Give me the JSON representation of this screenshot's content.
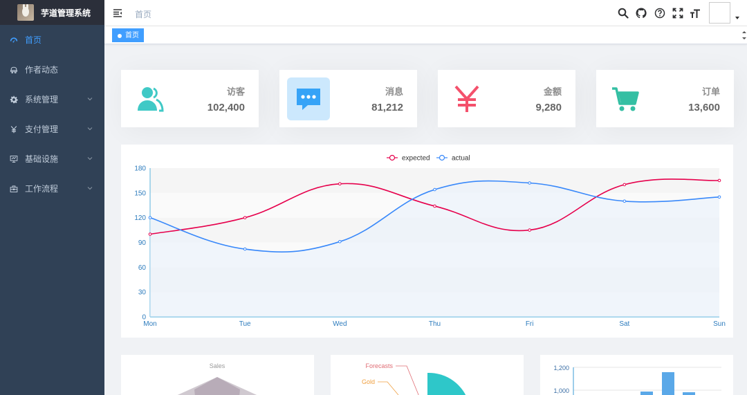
{
  "app": {
    "title": "芋道管理系统"
  },
  "sidebar": {
    "items": [
      {
        "label": "首页",
        "icon": "dashboard-icon",
        "active": true,
        "has_children": false
      },
      {
        "label": "作者动态",
        "icon": "guide-icon",
        "active": false,
        "has_children": false
      },
      {
        "label": "系统管理",
        "icon": "gear-icon",
        "active": false,
        "has_children": true
      },
      {
        "label": "支付管理",
        "icon": "yen-icon",
        "active": false,
        "has_children": true
      },
      {
        "label": "基础设施",
        "icon": "monitor-icon",
        "active": false,
        "has_children": true
      },
      {
        "label": "工作流程",
        "icon": "briefcase-icon",
        "active": false,
        "has_children": true
      }
    ]
  },
  "navbar": {
    "breadcrumb": "首页",
    "icons": [
      "search-icon",
      "github-icon",
      "help-icon",
      "fullscreen-icon",
      "font-size-icon"
    ]
  },
  "tags": [
    {
      "label": "首页",
      "active": true
    }
  ],
  "cards": [
    {
      "label": "访客",
      "value": "102,400",
      "icon": "visitors-icon",
      "color": "#40c9c6"
    },
    {
      "label": "消息",
      "value": "81,212",
      "icon": "message-icon",
      "color": "#36a3f7"
    },
    {
      "label": "金额",
      "value": "9,280",
      "icon": "money-icon",
      "color": "#f4516c"
    },
    {
      "label": "订单",
      "value": "13,600",
      "icon": "shopping-icon",
      "color": "#34bfa3"
    }
  ],
  "chart_data": [
    {
      "type": "line",
      "categories": [
        "Mon",
        "Tue",
        "Wed",
        "Thu",
        "Fri",
        "Sat",
        "Sun"
      ],
      "series": [
        {
          "name": "expected",
          "values": [
            100,
            120,
            161,
            134,
            105,
            160,
            165
          ],
          "color": "#e6004c"
        },
        {
          "name": "actual",
          "values": [
            120,
            82,
            91,
            154,
            162,
            140,
            145
          ],
          "color": "#3888fa"
        }
      ],
      "ylim": [
        0,
        180
      ],
      "yticks": [
        0,
        30,
        60,
        90,
        120,
        150,
        180
      ],
      "legend": "top-center",
      "grid": true
    },
    {
      "type": "radar",
      "title": "Sales"
    },
    {
      "type": "pie",
      "categories": [
        "Forecasts",
        "Gold"
      ]
    },
    {
      "type": "bar",
      "yticks_visible": [
        "1,200",
        "1,000"
      ]
    }
  ]
}
